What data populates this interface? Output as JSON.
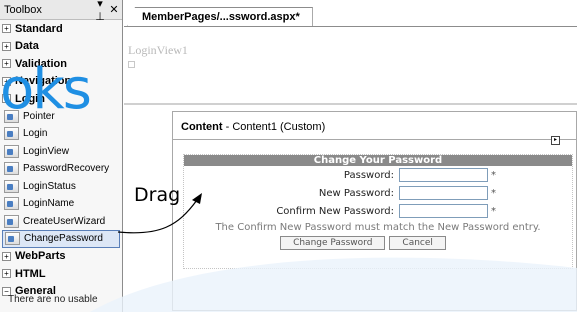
{
  "toolbox": {
    "title": "Toolbox",
    "pin_glyph": "▾ ⊥",
    "close_glyph": "✕",
    "categories_top": [
      {
        "expander": "+",
        "label": "Standard"
      },
      {
        "expander": "+",
        "label": "Data"
      },
      {
        "expander": "+",
        "label": "Validation"
      },
      {
        "expander": "+",
        "label": "Navigation"
      },
      {
        "expander": "−",
        "label": "Login"
      }
    ],
    "pointer_label": "Pointer",
    "controls": [
      {
        "label": "Login"
      },
      {
        "label": "LoginView"
      },
      {
        "label": "PasswordRecovery"
      },
      {
        "label": "LoginStatus"
      },
      {
        "label": "LoginName"
      },
      {
        "label": "CreateUserWizard"
      },
      {
        "label": "ChangePassword"
      }
    ],
    "categories_bottom": [
      {
        "expander": "+",
        "label": "WebParts"
      },
      {
        "expander": "+",
        "label": "HTML"
      },
      {
        "expander": "−",
        "label": "General"
      }
    ],
    "footer_text": "There are no usable"
  },
  "document": {
    "tab_label": "MemberPages/...ssword.aspx*",
    "loginview_label": "LoginView1",
    "content_header_bold": "Content",
    "content_header_rest": " - Content1 (Custom)",
    "change_password": {
      "title": "Change Your Password",
      "password_label": "Password:",
      "new_password_label": "New Password:",
      "confirm_label": "Confirm New Password:",
      "required_marker": "*",
      "compare_message": "The Confirm New Password must match the New Password entry.",
      "change_button": "Change Password",
      "cancel_button": "Cancel"
    }
  },
  "annotation": {
    "drag_text": "Drag",
    "watermark_text": "oks"
  },
  "colors": {
    "accent_blue": "#1f8fe3",
    "selection": "#dde7f6",
    "title_bar_grey": "#8a8a8a"
  }
}
